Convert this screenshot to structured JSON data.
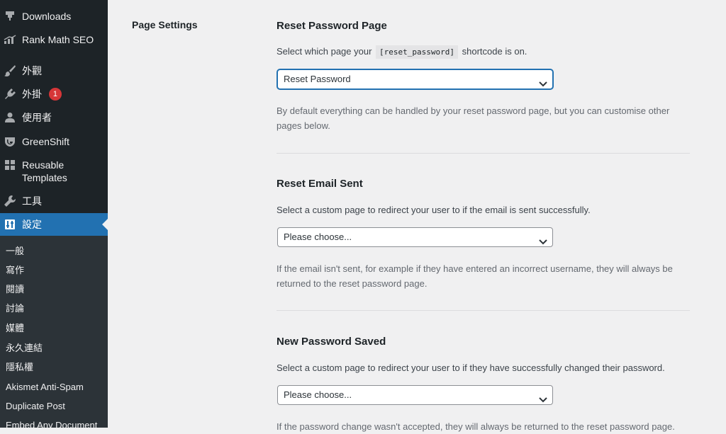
{
  "sidebar": {
    "menu": [
      {
        "label": "Downloads",
        "icon": "download-icon"
      },
      {
        "label": "Rank Math SEO",
        "icon": "rank-math-icon"
      },
      {
        "label": "外觀",
        "icon": "paintbrush-icon"
      },
      {
        "label": "外掛",
        "icon": "plugin-icon",
        "badge": "1"
      },
      {
        "label": "使用者",
        "icon": "user-icon"
      },
      {
        "label": "GreenShift",
        "icon": "greenshift-icon"
      },
      {
        "label": "Reusable Templates",
        "icon": "grid-icon"
      },
      {
        "label": "工具",
        "icon": "wrench-icon"
      },
      {
        "label": "設定",
        "icon": "settings-icon",
        "active": true
      }
    ],
    "submenu": [
      "一般",
      "寫作",
      "閱讀",
      "討論",
      "媒體",
      "永久連結",
      "隱私權",
      "Akismet Anti-Spam",
      "Duplicate Post",
      "Embed Any Document"
    ]
  },
  "main": {
    "side_heading": "Page Settings",
    "sections": [
      {
        "title": "Reset Password Page",
        "desc_before": "Select which page your",
        "desc_code": "[reset_password]",
        "desc_after": "shortcode is on.",
        "select_value": "Reset Password",
        "help": "By default everything can be handled by your reset password page, but you can customise other pages below."
      },
      {
        "title": "Reset Email Sent",
        "desc": "Select a custom page to redirect your user to if the email is sent successfully.",
        "select_value": "Please choose...",
        "help": "If the email isn't sent, for example if they have entered an incorrect username, they will always be returned to the reset password page."
      },
      {
        "title": "New Password Saved",
        "desc": "Select a custom page to redirect your user to if they have successfully changed their password.",
        "select_value": "Please choose...",
        "help": "If the password change wasn't accepted, they will always be returned to the reset password page."
      }
    ]
  },
  "colors": {
    "sidebar_bg": "#1d2327",
    "submenu_bg": "#2c3338",
    "accent": "#2271b1",
    "badge": "#d63638",
    "page_bg": "#f0f0f1"
  }
}
